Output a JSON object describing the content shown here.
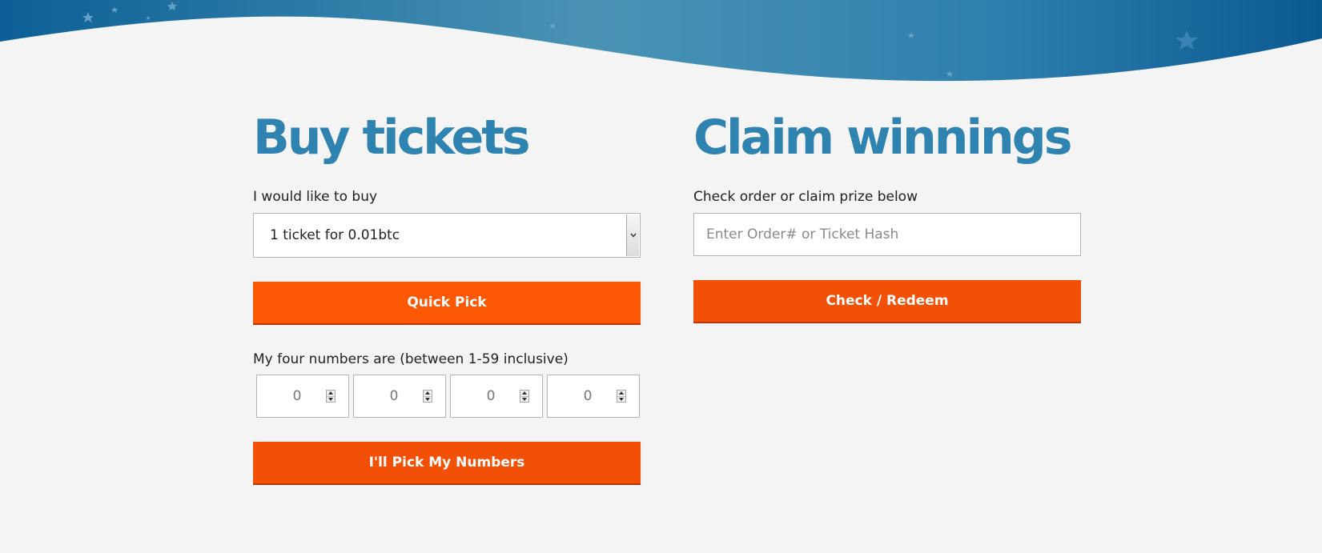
{
  "buy": {
    "heading": "Buy tickets",
    "quantity_label": "I would like to buy",
    "quantity_selected": "1 ticket for 0.01btc",
    "quick_pick_label": "Quick Pick",
    "numbers_label": "My four numbers are (between 1-59 inclusive)",
    "numbers": [
      "0",
      "0",
      "0",
      "0"
    ],
    "pick_label": "I'll Pick My Numbers"
  },
  "claim": {
    "heading": "Claim winnings",
    "check_label": "Check order or claim prize below",
    "input_placeholder": "Enter Order# or Ticket Hash",
    "check_button_label": "Check / Redeem"
  },
  "colors": {
    "heading": "#2e83b0",
    "button": "#f25006",
    "banner_dark": "#0c5f96",
    "banner_light": "#4aa0c4",
    "background": "#f4f4f4"
  },
  "icons": {
    "select_arrow": "chevron-down-icon",
    "spinner": "spinner-arrows-icon",
    "banner_decor": "star-icon"
  }
}
